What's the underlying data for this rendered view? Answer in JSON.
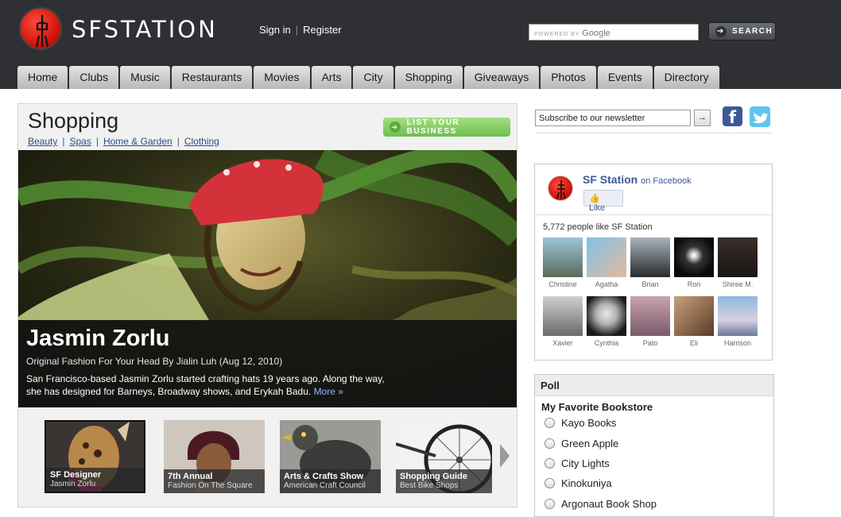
{
  "header": {
    "logo_text": "SFSTATION",
    "sign_in": "Sign in",
    "register": "Register",
    "search_placeholder_prefix": "POWERED BY",
    "search_placeholder_brand": "Google",
    "search_button": "SEARCH"
  },
  "nav": {
    "items": [
      "Home",
      "Clubs",
      "Music",
      "Restaurants",
      "Movies",
      "Arts",
      "City",
      "Shopping",
      "Giveaways",
      "Photos",
      "Events",
      "Directory"
    ]
  },
  "section": {
    "title": "Shopping",
    "subnav": [
      "Beauty",
      "Spas",
      "Home & Garden",
      "Clothing"
    ],
    "list_button": "LIST YOUR BUSINESS"
  },
  "hero": {
    "name": "Jasmin Zorlu",
    "subtitle": "Original Fashion For Your Head By Jialin Luh (Aug 12, 2010)",
    "description": "San Francisco-based Jasmin Zorlu started crafting hats 19 years ago. Along the way, she has designed for Barneys, Broadway shows, and Erykah Badu.",
    "more": "More »"
  },
  "thumbs": [
    {
      "title": "SF Designer",
      "subtitle": "Jasmin Zorlu"
    },
    {
      "title": "7th Annual",
      "subtitle": "Fashion On The Square"
    },
    {
      "title": "Arts & Crafts Show",
      "subtitle": "American Craft Council"
    },
    {
      "title": "Shopping Guide",
      "subtitle": "Best Bike Shops"
    }
  ],
  "sidebar": {
    "newsletter_value": "Subscribe to our newsletter",
    "newsletter_go": "→",
    "facebook": {
      "page_name": "SF Station",
      "on_facebook": "on Facebook",
      "like": "Like",
      "count_text": "5,772 people like SF Station",
      "faces": [
        "Christine",
        "Agatha",
        "Brian",
        "Ron",
        "Shiree M.",
        "Xavier",
        "Cynthia",
        "Pato",
        "Eli",
        "Harrison"
      ]
    },
    "poll": {
      "heading": "Poll",
      "question": "My Favorite Bookstore",
      "options": [
        "Kayo Books",
        "Green Apple",
        "City Lights",
        "Kinokuniya",
        "Argonaut Book Shop"
      ]
    }
  },
  "colors": {
    "header_bg": "#2e3033",
    "logo_red": "#c90f08",
    "link_blue": "#2d4f86",
    "facebook_blue": "#3b5998",
    "twitter_blue": "#5fc5ef",
    "list_button_green": "#6cbf4c"
  }
}
